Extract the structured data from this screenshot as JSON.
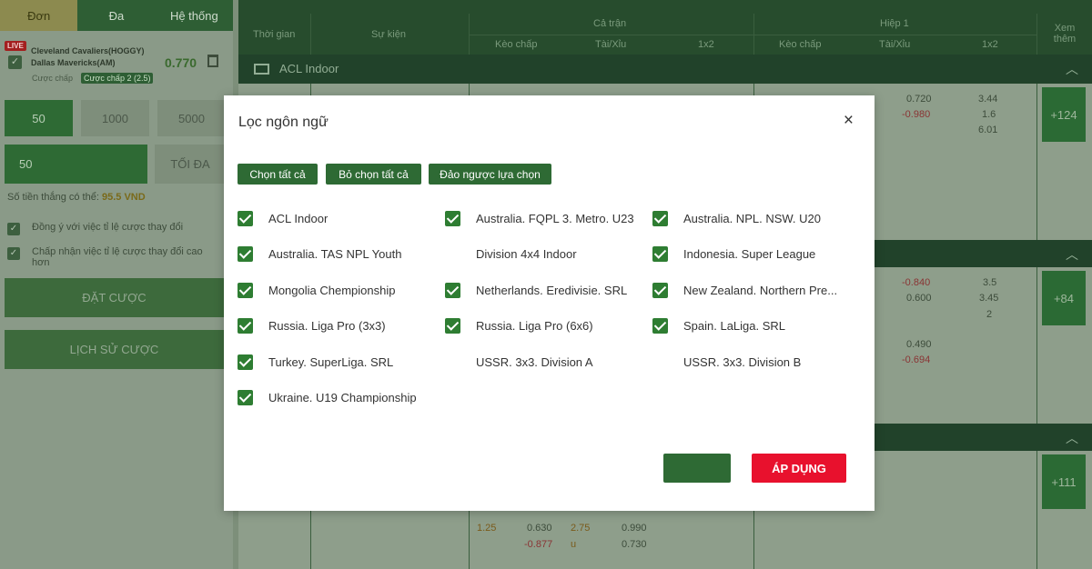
{
  "left_panel": {
    "tabs": [
      "Đơn",
      "Đa",
      "Hệ thống"
    ],
    "bet": {
      "live_badge": "LIVE",
      "team1": "Cleveland Cavaliers(HOGGY)",
      "team2": "Dallas Mavericks(AM)",
      "odds": "0.770",
      "bet_type_label": "Cược chấp",
      "bet_type_value": "Cược chấp 2 (2.5)"
    },
    "stakes": [
      "50",
      "1000",
      "5000"
    ],
    "amount": "50",
    "max_label": "TỐI ĐA",
    "win_label": "Số tiền thắng có thể:",
    "win_value": "95.5 VND",
    "option1": "Đồng ý với việc tỉ lệ cược thay đổi",
    "option2": "Chấp nhận việc tỉ lệ cược thay đổi cao hơn",
    "place_bet": "ĐẶT CƯỢC",
    "history": "LỊCH SỬ CƯỢC"
  },
  "table": {
    "headers": {
      "time": "Thời gian",
      "event": "Sự kiện",
      "full_match": "Cả trận",
      "first_half": "Hiệp 1",
      "handicap": "Kèo chấp",
      "over_under": "Tài/Xỉu",
      "one_x_two": "1x2",
      "see_more": "Xem thêm"
    },
    "league": "ACL Indoor",
    "see_more_counts": [
      "+124",
      "+84",
      "+111"
    ],
    "row1": {
      "h1_ou": "0.720",
      "h1_ou2": "-0.980",
      "x1": "3.44",
      "x2": "1.6",
      "x3": "6.01"
    },
    "row2": {
      "h1_ou": "-0.840",
      "h1_ou2": "0.600",
      "x1": "3.5",
      "x2": "3.45",
      "x3": "2"
    },
    "row3": {
      "h1_ou": "0.490",
      "h1_ou2": "-0.694"
    },
    "row4": {
      "hdp": "1.25",
      "hdp_odds": "0.630",
      "hdp_odds2": "-0.877",
      "ou": "2.75",
      "ou_side": "u",
      "ou_odds": "0.990",
      "ou_odds2": "0.730"
    }
  },
  "modal": {
    "title": "Lọc ngôn ngữ",
    "close": "×",
    "buttons": [
      "Chọn tất cả",
      "Bỏ chọn tất cả",
      "Đảo ngược lựa chọn"
    ],
    "apply": "ÁP DỤNG",
    "leagues": [
      {
        "label": "ACL Indoor",
        "checked": true
      },
      {
        "label": "Australia. FQPL 3. Metro. U23",
        "checked": true
      },
      {
        "label": "Australia. NPL. NSW. U20",
        "checked": true
      },
      {
        "label": "Australia. TAS NPL Youth",
        "checked": true
      },
      {
        "label": "Division 4x4 Indoor",
        "checked": false
      },
      {
        "label": "Indonesia. Super League",
        "checked": true
      },
      {
        "label": "Mongolia Chempionship",
        "checked": true
      },
      {
        "label": "Netherlands. Eredivisie. SRL",
        "checked": true
      },
      {
        "label": "New Zealand. Northern Pre...",
        "checked": true
      },
      {
        "label": "Russia. Liga Pro (3x3)",
        "checked": true
      },
      {
        "label": "Russia. Liga Pro (6x6)",
        "checked": true
      },
      {
        "label": "Spain. LaLiga. SRL",
        "checked": true
      },
      {
        "label": "Turkey. SuperLiga. SRL",
        "checked": true
      },
      {
        "label": "USSR. 3x3. Division A",
        "checked": false
      },
      {
        "label": "USSR. 3x3. Division B",
        "checked": false
      },
      {
        "label": "Ukraine. U19 Championship",
        "checked": true
      }
    ]
  },
  "colors": {
    "accent": "#2e7d32",
    "apply": "#e8112d",
    "arrow": "#f7ef00"
  }
}
